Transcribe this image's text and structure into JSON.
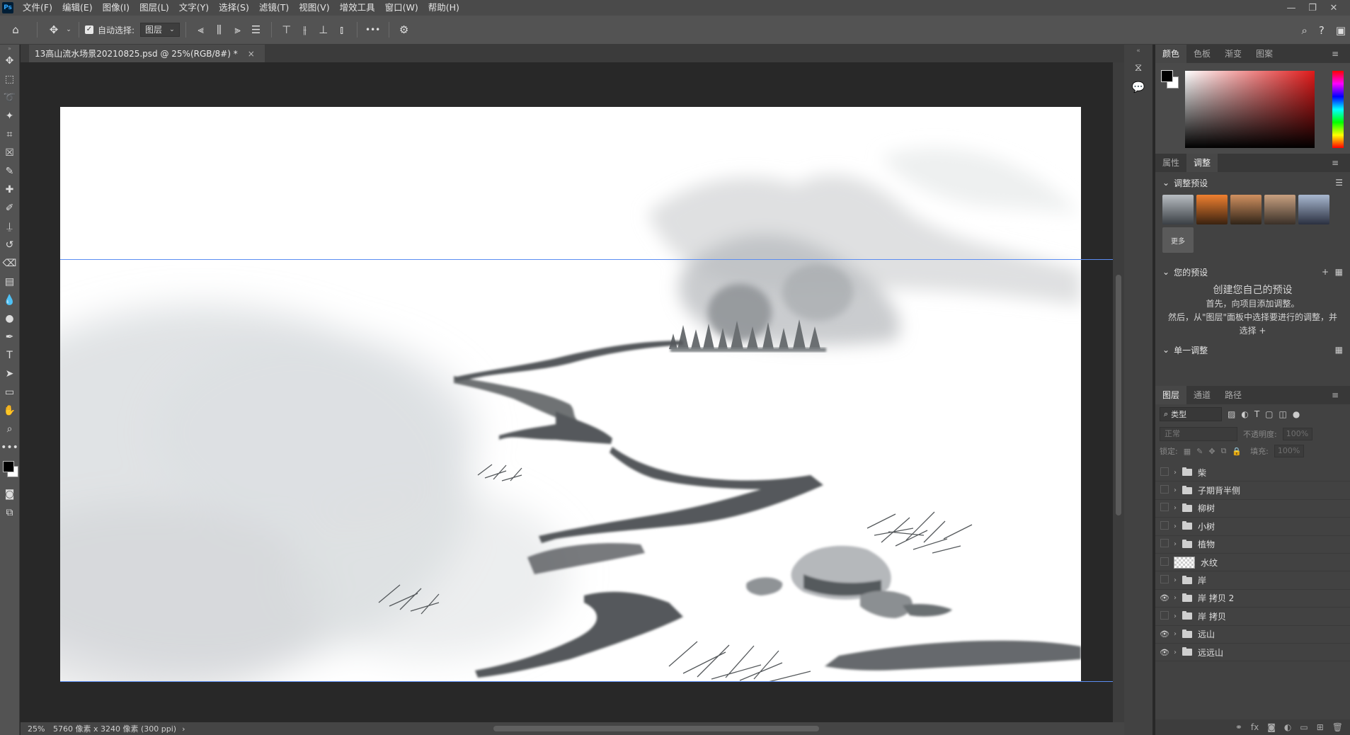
{
  "app": {
    "logo": "Ps"
  },
  "menu": [
    "文件(F)",
    "编辑(E)",
    "图像(I)",
    "图层(L)",
    "文字(Y)",
    "选择(S)",
    "滤镜(T)",
    "视图(V)",
    "增效工具",
    "窗口(W)",
    "帮助(H)"
  ],
  "window_controls": [
    "—",
    "❐",
    "✕"
  ],
  "options": {
    "auto_select_label": "自动选择:",
    "auto_select_target": "图层",
    "more": "•••"
  },
  "document": {
    "tab_title": "13高山流水场景20210825.psd @ 25%(RGB/8#) *",
    "tab_close": "×",
    "zoom": "25%",
    "doc_info": "5760 像素 x 3240 像素 (300 ppi)",
    "status_arrow": "›"
  },
  "color_panel": {
    "tabs": [
      "颜色",
      "色板",
      "渐变",
      "图案"
    ],
    "foreground": "#000000",
    "background": "#ffffff",
    "hue_selected": "#e01a1a"
  },
  "adjust_panel": {
    "tabs": [
      "属性",
      "调整"
    ],
    "presets_header": "调整预设",
    "more_label": "更多",
    "your_presets_header": "您的预设",
    "create_title": "创建您自己的预设",
    "create_line1": "首先，向项目添加调整。",
    "create_line2": "然后，从\"图层\"面板中选择要进行的调整，并",
    "create_line3": "选择 +",
    "single_adjust_header": "单一调整"
  },
  "layers_panel": {
    "tabs": [
      "图层",
      "通道",
      "路径"
    ],
    "filter_label": "类型",
    "blend_mode": "正常",
    "opacity_label": "不透明度:",
    "opacity_value": "100%",
    "lock_label": "锁定:",
    "fill_label": "填充:",
    "fill_value": "100%",
    "layers": [
      {
        "name": "柴",
        "type": "group",
        "visible": false
      },
      {
        "name": "子期背半侧",
        "type": "group",
        "visible": false
      },
      {
        "name": "柳树",
        "type": "group",
        "visible": false
      },
      {
        "name": "小树",
        "type": "group",
        "visible": false
      },
      {
        "name": "植物",
        "type": "group",
        "visible": false
      },
      {
        "name": "水纹",
        "type": "pixel",
        "visible": false
      },
      {
        "name": "岸",
        "type": "group",
        "visible": false
      },
      {
        "name": "岸 拷贝 2",
        "type": "group",
        "visible": true
      },
      {
        "name": "岸 拷贝",
        "type": "group",
        "visible": false
      },
      {
        "name": "远山",
        "type": "group",
        "visible": true
      },
      {
        "name": "远远山",
        "type": "group",
        "visible": true
      }
    ],
    "footer_icons": [
      "link-icon",
      "fx-icon",
      "mask-icon",
      "adjustment-icon",
      "folder-icon",
      "new-layer-icon",
      "trash-icon"
    ]
  }
}
